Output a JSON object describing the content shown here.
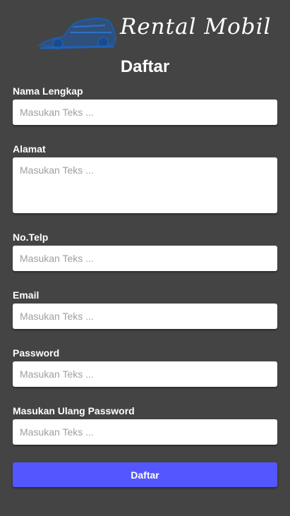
{
  "brand": {
    "name": "Rental Mobil",
    "logo_icon": "car-icon",
    "logo_color": "#1f5ba8"
  },
  "title": "Daftar",
  "fields": [
    {
      "label": "Nama Lengkap",
      "placeholder": "Masukan Teks ..."
    },
    {
      "label": "Alamat",
      "placeholder": "Masukan Teks ..."
    },
    {
      "label": "No.Telp",
      "placeholder": "Masukan Teks ..."
    },
    {
      "label": "Email",
      "placeholder": "Masukan Teks ..."
    },
    {
      "label": "Password",
      "placeholder": "Masukan Teks ..."
    },
    {
      "label": "Masukan Ulang Password",
      "placeholder": "Masukan Teks ..."
    }
  ],
  "submit_label": "Daftar",
  "colors": {
    "background": "#444444",
    "button": "#5457ff",
    "input": "#ffffff"
  }
}
